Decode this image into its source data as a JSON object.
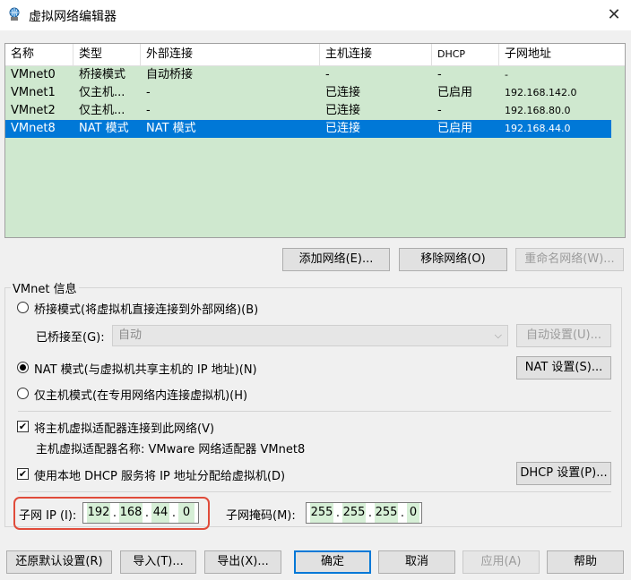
{
  "window": {
    "title": "虚拟网络编辑器",
    "close_glyph": "✕",
    "icon": "network-editor-icon"
  },
  "table": {
    "headers": [
      "名称",
      "类型",
      "外部连接",
      "主机连接",
      "DHCP",
      "子网地址"
    ],
    "rows": [
      {
        "name": "VMnet0",
        "type": "桥接模式",
        "external": "自动桥接",
        "host": "-",
        "dhcp": "-",
        "subnet": "-"
      },
      {
        "name": "VMnet1",
        "type": "仅主机...",
        "external": "-",
        "host": "已连接",
        "dhcp": "已启用",
        "subnet": "192.168.142.0"
      },
      {
        "name": "VMnet2",
        "type": "仅主机...",
        "external": "-",
        "host": "已连接",
        "dhcp": "-",
        "subnet": "192.168.80.0"
      },
      {
        "name": "VMnet8",
        "type": "NAT 模式",
        "external": "NAT 模式",
        "host": "已连接",
        "dhcp": "已启用",
        "subnet": "192.168.44.0"
      }
    ],
    "selected_index": 3,
    "row_bg": "#cfe8cf",
    "selected_bg": "#0078d7"
  },
  "network_buttons": {
    "add": "添加网络(E)...",
    "remove": "移除网络(O)",
    "rename": "重命名网络(W)..."
  },
  "vmnet_info": {
    "legend": "VMnet 信息",
    "bridged_label": "桥接模式(将虚拟机直接连接到外部网络)(B)",
    "bridged_to_label": "已桥接至(G):",
    "bridged_to_value": "自动",
    "auto_settings": "自动设置(U)...",
    "nat_label": "NAT 模式(与虚拟机共享主机的 IP 地址)(N)",
    "nat_settings": "NAT 设置(S)...",
    "hostonly_label": "仅主机模式(在专用网络内连接虚拟机)(H)",
    "connect_adapter_label": "将主机虚拟适配器连接到此网络(V)",
    "adapter_name_label": "主机虚拟适配器名称: VMware 网络适配器 VMnet8",
    "dhcp_label": "使用本地 DHCP 服务将 IP 地址分配给虚拟机(D)",
    "dhcp_settings": "DHCP 设置(P)...",
    "subnet_ip_label": "子网 IP (I):",
    "subnet_ip": [
      "192",
      "168",
      "44",
      "0"
    ],
    "subnet_mask_label": "子网掩码(M):",
    "subnet_mask": [
      "255",
      "255",
      "255",
      "0"
    ],
    "highlight_color": "#e04b3a"
  },
  "footer": {
    "restore": "还原默认设置(R)",
    "import": "导入(T)...",
    "export": "导出(X)...",
    "ok": "确定",
    "cancel": "取消",
    "apply": "应用(A)",
    "help": "帮助"
  }
}
